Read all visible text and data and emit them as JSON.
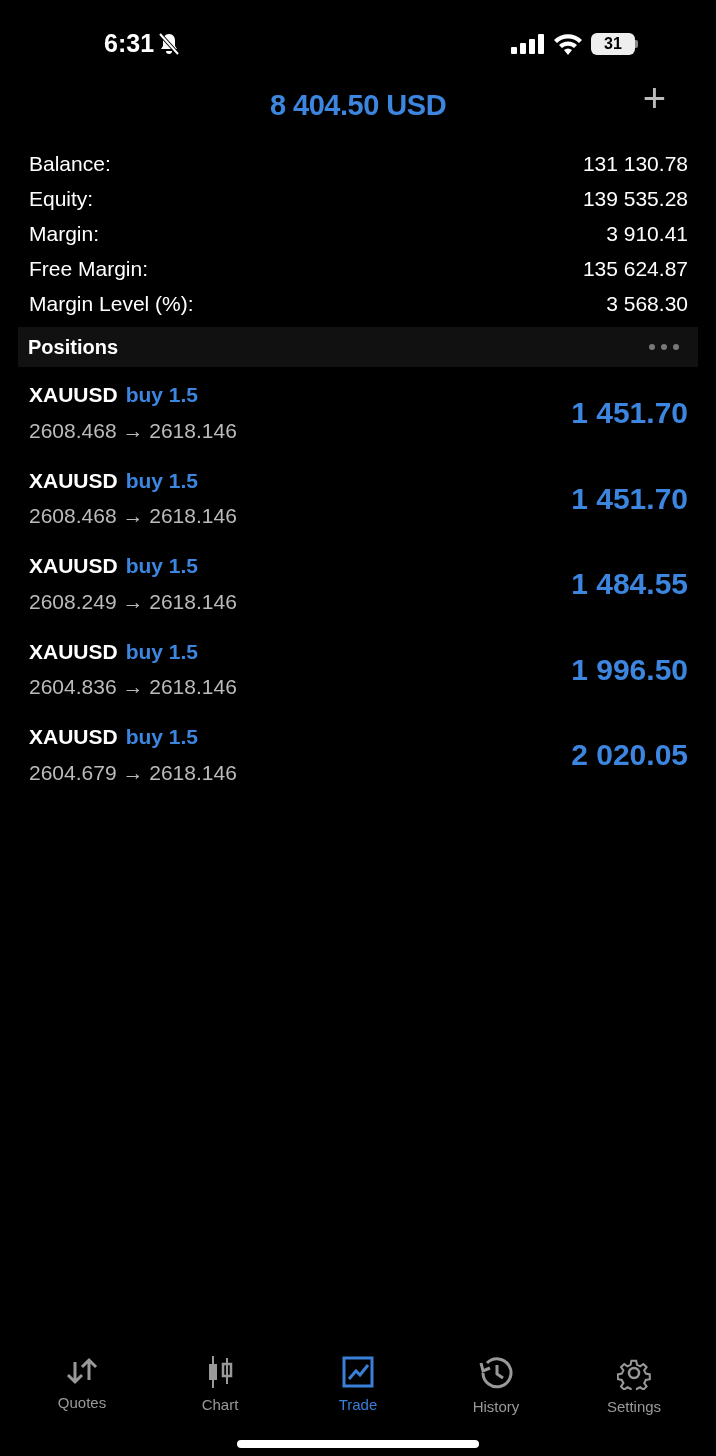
{
  "status_bar": {
    "time": "6:31",
    "battery": "31"
  },
  "header": {
    "title": "8 404.50 USD",
    "add_symbol": "+"
  },
  "summary": [
    {
      "label": "Balance:",
      "value": "131 130.78"
    },
    {
      "label": "Equity:",
      "value": "139 535.28"
    },
    {
      "label": "Margin:",
      "value": "3 910.41"
    },
    {
      "label": "Free Margin:",
      "value": "135 624.87"
    },
    {
      "label": "Margin Level (%):",
      "value": "3 568.30"
    }
  ],
  "positions": {
    "title": "Positions",
    "rows": [
      {
        "symbol": "XAUUSD",
        "side": "buy 1.5",
        "prices": "2608.468 → 2618.146",
        "profit": "1 451.70"
      },
      {
        "symbol": "XAUUSD",
        "side": "buy 1.5",
        "prices": "2608.468 → 2618.146",
        "profit": "1 451.70"
      },
      {
        "symbol": "XAUUSD",
        "side": "buy 1.5",
        "prices": "2608.249 → 2618.146",
        "profit": "1 484.55"
      },
      {
        "symbol": "XAUUSD",
        "side": "buy 1.5",
        "prices": "2604.836 → 2618.146",
        "profit": "1 996.50"
      },
      {
        "symbol": "XAUUSD",
        "side": "buy 1.5",
        "prices": "2604.679 → 2618.146",
        "profit": "2 020.05"
      }
    ]
  },
  "tabs": [
    {
      "label": "Quotes",
      "kind": "quotes",
      "selected": false
    },
    {
      "label": "Chart",
      "kind": "chart",
      "selected": false
    },
    {
      "label": "Trade",
      "kind": "trade",
      "selected": true
    },
    {
      "label": "History",
      "kind": "history",
      "selected": false
    },
    {
      "label": "Settings",
      "kind": "settings",
      "selected": false
    }
  ]
}
